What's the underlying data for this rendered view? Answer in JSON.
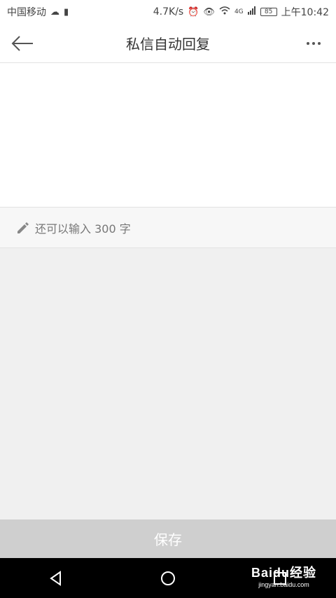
{
  "status_bar": {
    "carrier": "中国移动",
    "speed": "4.7K/s",
    "network": "4G",
    "battery": "85",
    "time": "上午10:42"
  },
  "header": {
    "title": "私信自动回复",
    "back_icon": "arrow-left-icon",
    "more_icon": "more-horizontal-icon"
  },
  "editor": {
    "value": "",
    "placeholder": ""
  },
  "counter": {
    "text": "还可以输入 300 字",
    "icon": "pencil-icon"
  },
  "save_label": "保存",
  "nav": {
    "back_icon": "triangle-back-icon",
    "home_icon": "circle-home-icon",
    "recent_icon": "square-recent-icon"
  },
  "watermark": {
    "brand": "Baidu经验",
    "url": "jingyan.baidu.com"
  },
  "colors": {
    "background": "#f0f0f0",
    "surface": "#ffffff",
    "save_button": "#cfcfcf",
    "nav_bar": "#000000",
    "muted_text": "#777777"
  }
}
